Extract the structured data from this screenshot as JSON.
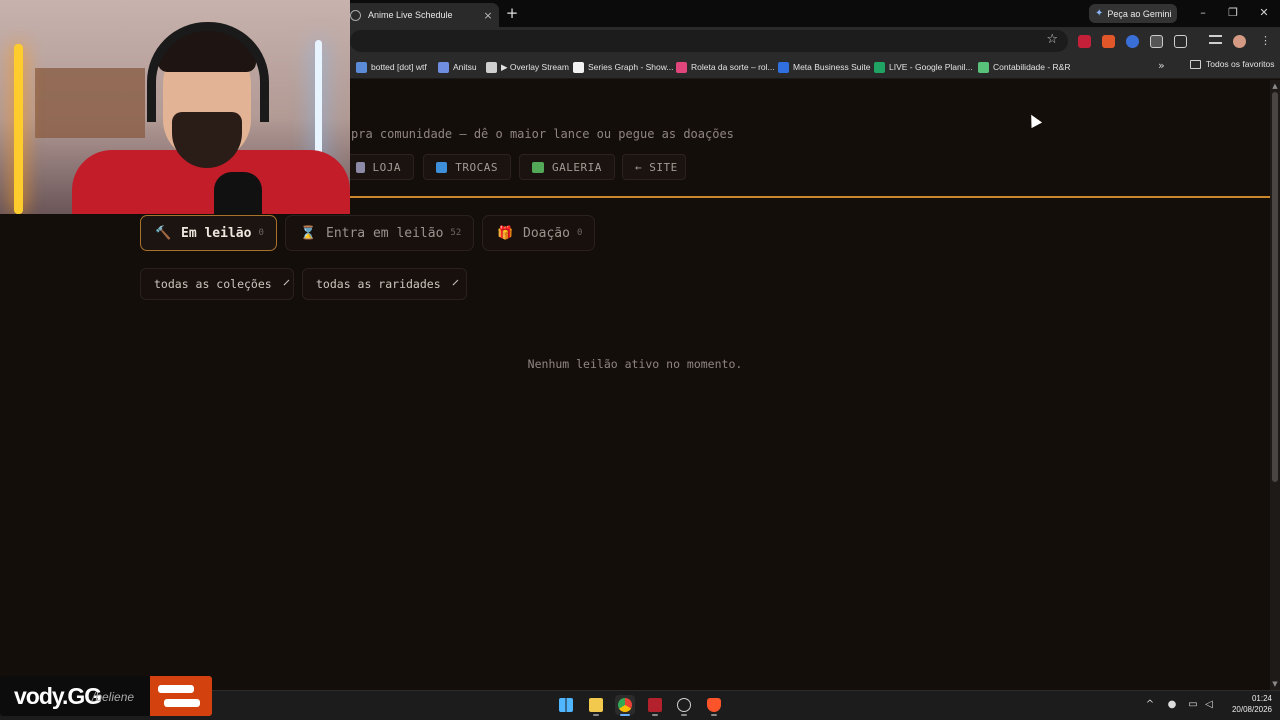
{
  "browser": {
    "tab_title": "Anime Live Schedule",
    "tab_close_glyph": "×",
    "new_tab_glyph": "+",
    "gemini_label": "Peça ao Gemini",
    "window_controls": {
      "minimize": "–",
      "restore": "❐",
      "close": "✕"
    },
    "star_glyph": "☆",
    "bookmarks": [
      {
        "label": "botted [dot] wtf",
        "icon_color": "#5b8bd6"
      },
      {
        "label": "Anitsu",
        "icon_color": "#6f8ee0"
      },
      {
        "label": "▶ Overlay Stream",
        "icon_color": "#cfcfcf"
      },
      {
        "label": "Series Graph - Show...",
        "icon_color": "#f2f2f2"
      },
      {
        "label": "Roleta da sorte – rol...",
        "icon_color": "#e0457b"
      },
      {
        "label": "Meta Business Suite",
        "icon_color": "#2f6fe0"
      },
      {
        "label": "LIVE - Google Planil...",
        "icon_color": "#1fa463"
      },
      {
        "label": "Contabilidade - R&R",
        "icon_color": "#58c27a"
      }
    ],
    "bookmarks_more_glyph": "»",
    "all_bookmarks_label": "Todos os favoritos"
  },
  "page": {
    "tagline": "pra comunidade — dê o maior lance ou pegue as doações",
    "nav": [
      {
        "label": "LOJA",
        "icon": "cart-icon",
        "icon_color": "#8c8aa6"
      },
      {
        "label": "TROCAS",
        "icon": "swap-icon",
        "icon_color": "#3d8fd9"
      },
      {
        "label": "GALERIA",
        "icon": "gallery-icon",
        "icon_color": "#53a957"
      },
      {
        "label": "← SITE",
        "icon": "",
        "icon_color": ""
      }
    ],
    "accent_color": "#c9862b",
    "tabs": [
      {
        "icon_glyph": "🔨",
        "label": "Em leilão",
        "count": "0",
        "active": true
      },
      {
        "icon_glyph": "⌛",
        "label": "Entra em leilão",
        "count": "52",
        "active": false
      },
      {
        "icon_glyph": "🎁",
        "label": "Doação",
        "count": "0",
        "active": false
      }
    ],
    "filters": {
      "collections": "todas as coleções",
      "rarities": "todas as raridades"
    },
    "empty_message": "Nenhum leilão ativo no momento."
  },
  "scrollbar": {
    "up_glyph": "▲",
    "down_glyph": "▼"
  },
  "overlay": {
    "logo_text": "vody.GG",
    "logo_sub": "/beliene"
  },
  "taskbar": {
    "apps": [
      "windows-start",
      "file-explorer",
      "chrome",
      "stream-app",
      "app-settings",
      "brave"
    ],
    "tray_chevron": "^",
    "time": "01:24",
    "date": "20/08/2026"
  }
}
